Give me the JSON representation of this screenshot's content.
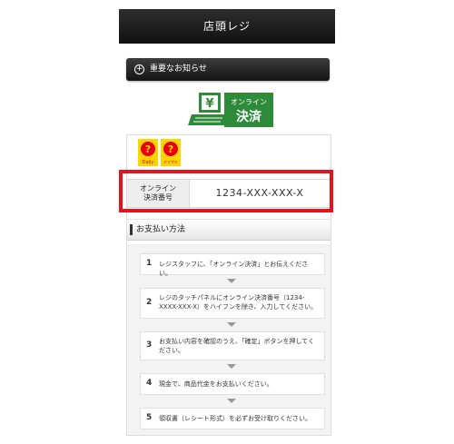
{
  "header": {
    "title": "店頭レジ"
  },
  "notice": {
    "label": "重要なお知らせ"
  },
  "logo": {
    "line1": "オンライン",
    "line2": "決済",
    "symbol": "¥"
  },
  "brand": {
    "daily": "Daily",
    "yamazaki": "ヤマザキ"
  },
  "payment_number": {
    "label_line1": "オンライン",
    "label_line2": "決済番号",
    "value": "1234-XXX-XXX-X"
  },
  "section": {
    "title": "お支払い方法"
  },
  "steps": [
    {
      "num": "1",
      "text": "レジスタッフに、「オンライン決済」とお伝えください。"
    },
    {
      "num": "2",
      "text": "レジのタッチパネルにオンライン決済番号（1234-XXXX-XXX-X）をハイフンを除き、入力してください。"
    },
    {
      "num": "3",
      "text": "お支払い内容を確認のうえ、「確定」ボタンを押してください。"
    },
    {
      "num": "4",
      "text": "現金で、商品代金をお支払いください。"
    },
    {
      "num": "5",
      "text": "領収書（レシート形式）を必ずお受け取りください。"
    }
  ],
  "colors": {
    "highlight": "#e4141d",
    "logo_green": "#2e8b3a",
    "brand_red": "#e60012",
    "brand_yellow": "#ffd400"
  }
}
